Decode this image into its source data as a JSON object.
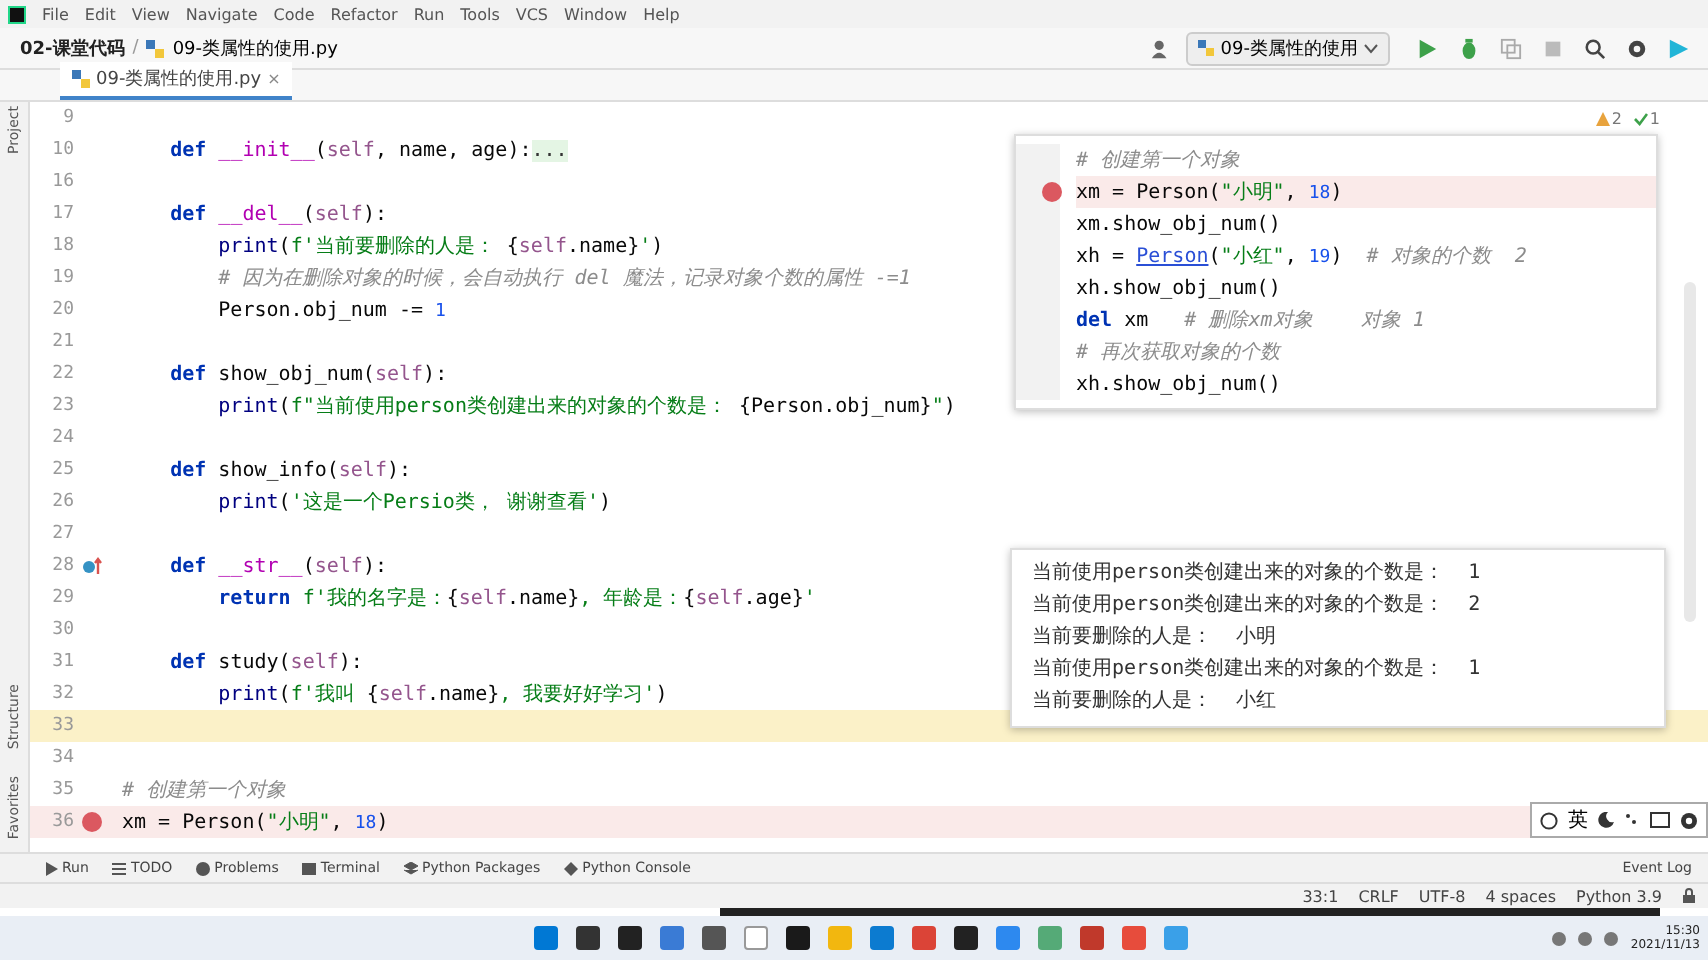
{
  "menu": [
    "File",
    "Edit",
    "View",
    "Navigate",
    "Code",
    "Refactor",
    "Run",
    "Tools",
    "VCS",
    "Window",
    "Help"
  ],
  "breadcrumb": {
    "project": "02-课堂代码",
    "separator": "/",
    "file": "09-类属性的使用.py"
  },
  "run_config": "09-类属性的使用",
  "tabs": [
    {
      "label": "09-类属性的使用.py",
      "close": "×",
      "selected": true
    }
  ],
  "side_tabs_top": [
    "Project"
  ],
  "side_tabs_bottom": [
    "Structure",
    "Favorites"
  ],
  "inspections": {
    "warnings": "2",
    "ok": "1"
  },
  "lines": [
    {
      "number": "9",
      "kind": "plain",
      "current": false
    },
    {
      "number": "10",
      "kind": "plain",
      "current": false,
      "segments": [
        {
          "kind": "kw",
          "text": "    def "
        },
        {
          "kind": "dunder",
          "text": "__init__"
        },
        {
          "kind": "plain",
          "text": "("
        },
        {
          "kind": "self",
          "text": "self"
        },
        {
          "kind": "plain",
          "text": ", name, age):"
        },
        {
          "kind": "folded",
          "text": "..."
        }
      ]
    },
    {
      "number": "16",
      "kind": "plain",
      "current": false
    },
    {
      "number": "17",
      "kind": "plain",
      "current": false,
      "segments": [
        {
          "kind": "kw",
          "text": "    def "
        },
        {
          "kind": "dunder",
          "text": "__del__"
        },
        {
          "kind": "plain",
          "text": "("
        },
        {
          "kind": "self",
          "text": "self"
        },
        {
          "kind": "plain",
          "text": "):"
        }
      ]
    },
    {
      "number": "18",
      "kind": "plain",
      "current": false,
      "segments": [
        {
          "kind": "builtin",
          "text": "        print"
        },
        {
          "kind": "plain",
          "text": "("
        },
        {
          "kind": "str",
          "text": "f'当前要删除的人是： "
        },
        {
          "kind": "plain",
          "text": "{"
        },
        {
          "kind": "self",
          "text": "self"
        },
        {
          "kind": "plain",
          "text": ".name}"
        },
        {
          "kind": "str",
          "text": "'"
        },
        {
          "kind": "plain",
          "text": ")"
        }
      ]
    },
    {
      "number": "19",
      "kind": "plain",
      "current": false,
      "segments": [
        {
          "kind": "comment",
          "text": "        # 因为在删除对象的时候，会自动执行 del 魔法，记录对象个数的属性 -=1"
        }
      ]
    },
    {
      "number": "20",
      "kind": "plain",
      "current": false,
      "segments": [
        {
          "kind": "plain",
          "text": "        Person.obj_num -= "
        },
        {
          "kind": "num",
          "text": "1"
        }
      ]
    },
    {
      "number": "21",
      "kind": "plain",
      "current": false
    },
    {
      "number": "22",
      "kind": "plain",
      "current": false,
      "segments": [
        {
          "kind": "kw",
          "text": "    def "
        },
        {
          "kind": "plain",
          "text": "show_obj_num("
        },
        {
          "kind": "self",
          "text": "self"
        },
        {
          "kind": "plain",
          "text": "):"
        }
      ]
    },
    {
      "number": "23",
      "kind": "plain",
      "current": false,
      "segments": [
        {
          "kind": "builtin",
          "text": "        print"
        },
        {
          "kind": "plain",
          "text": "("
        },
        {
          "kind": "str",
          "text": "f\"当前使用person类创建出来的对象的个数是： "
        },
        {
          "kind": "plain",
          "text": "{Person.obj_num}"
        },
        {
          "kind": "str",
          "text": "\""
        },
        {
          "kind": "plain",
          "text": ")"
        }
      ]
    },
    {
      "number": "24",
      "kind": "plain",
      "current": false
    },
    {
      "number": "25",
      "kind": "plain",
      "current": false,
      "segments": [
        {
          "kind": "kw",
          "text": "    def "
        },
        {
          "kind": "plain",
          "text": "show_info("
        },
        {
          "kind": "self",
          "text": "self"
        },
        {
          "kind": "plain",
          "text": "):"
        }
      ]
    },
    {
      "number": "26",
      "kind": "plain",
      "current": false,
      "segments": [
        {
          "kind": "builtin",
          "text": "        print"
        },
        {
          "kind": "plain",
          "text": "("
        },
        {
          "kind": "str",
          "text": "'这是一个Persio类， 谢谢查看'"
        },
        {
          "kind": "plain",
          "text": ")"
        }
      ]
    },
    {
      "number": "27",
      "kind": "plain",
      "current": false
    },
    {
      "number": "28",
      "kind": "override",
      "current": false,
      "segments": [
        {
          "kind": "kw",
          "text": "    def "
        },
        {
          "kind": "dunder",
          "text": "__str__"
        },
        {
          "kind": "plain",
          "text": "("
        },
        {
          "kind": "self",
          "text": "self"
        },
        {
          "kind": "plain",
          "text": "):"
        }
      ]
    },
    {
      "number": "29",
      "kind": "plain",
      "current": false,
      "segments": [
        {
          "kind": "kw",
          "text": "        return "
        },
        {
          "kind": "str",
          "text": "f'我的名字是："
        },
        {
          "kind": "plain",
          "text": "{"
        },
        {
          "kind": "self",
          "text": "self"
        },
        {
          "kind": "plain",
          "text": ".name}"
        },
        {
          "kind": "str",
          "text": ", 年龄是："
        },
        {
          "kind": "plain",
          "text": "{"
        },
        {
          "kind": "self",
          "text": "self"
        },
        {
          "kind": "plain",
          "text": ".age}"
        },
        {
          "kind": "str",
          "text": "'"
        }
      ]
    },
    {
      "number": "30",
      "kind": "plain",
      "current": false
    },
    {
      "number": "31",
      "kind": "plain",
      "current": false,
      "segments": [
        {
          "kind": "kw",
          "text": "    def "
        },
        {
          "kind": "plain",
          "text": "study("
        },
        {
          "kind": "self",
          "text": "self"
        },
        {
          "kind": "plain",
          "text": "):"
        }
      ]
    },
    {
      "number": "32",
      "kind": "plain",
      "current": false,
      "segments": [
        {
          "kind": "builtin",
          "text": "        print"
        },
        {
          "kind": "plain",
          "text": "("
        },
        {
          "kind": "str",
          "text": "f'我叫 "
        },
        {
          "kind": "plain",
          "text": "{"
        },
        {
          "kind": "self",
          "text": "self"
        },
        {
          "kind": "plain",
          "text": ".name}"
        },
        {
          "kind": "str",
          "text": ", 我要好好学习'"
        },
        {
          "kind": "plain",
          "text": ")"
        }
      ]
    },
    {
      "number": "33",
      "kind": "plain",
      "current": true
    },
    {
      "number": "34",
      "kind": "plain",
      "current": false
    },
    {
      "number": "35",
      "kind": "plain",
      "current": false,
      "segments": [
        {
          "kind": "comment",
          "text": "# 创建第一个对象"
        }
      ]
    },
    {
      "number": "36",
      "kind": "breakpoint",
      "current": false,
      "segments": [
        {
          "kind": "plain",
          "text": "xm = Person("
        },
        {
          "kind": "str",
          "text": "\"小明\""
        },
        {
          "kind": "plain",
          "text": ", "
        },
        {
          "kind": "num",
          "text": "18"
        },
        {
          "kind": "plain",
          "text": ")"
        }
      ]
    }
  ],
  "preview_lines": [
    {
      "kind": "plain",
      "segments": [
        {
          "kind": "comment",
          "text": "# 创建第一个对象"
        }
      ]
    },
    {
      "kind": "breakpoint",
      "segments": [
        {
          "kind": "plain",
          "text": "xm = Person("
        },
        {
          "kind": "str",
          "text": "\"小明\""
        },
        {
          "kind": "plain",
          "text": ", "
        },
        {
          "kind": "num",
          "text": "18"
        },
        {
          "kind": "plain",
          "text": ")"
        }
      ]
    },
    {
      "kind": "plain",
      "segments": [
        {
          "kind": "plain",
          "text": "xm.show_obj_num()"
        }
      ]
    },
    {
      "kind": "plain",
      "segments": [
        {
          "kind": "plain",
          "text": "xh = "
        },
        {
          "kind": "link",
          "text": "Person"
        },
        {
          "kind": "plain",
          "text": "("
        },
        {
          "kind": "str",
          "text": "\"小红\""
        },
        {
          "kind": "plain",
          "text": ", "
        },
        {
          "kind": "num",
          "text": "19"
        },
        {
          "kind": "plain",
          "text": ")"
        },
        {
          "kind": "comment",
          "text": "  # 对象的个数  2"
        }
      ]
    },
    {
      "kind": "plain",
      "segments": [
        {
          "kind": "plain",
          "text": "xh.show_obj_num()"
        }
      ]
    },
    {
      "kind": "plain",
      "segments": [
        {
          "kind": "kw",
          "text": "del"
        },
        {
          "kind": "plain",
          "text": " xm"
        },
        {
          "kind": "comment",
          "text": "   # 删除xm对象    对象 1"
        }
      ]
    },
    {
      "kind": "plain",
      "segments": [
        {
          "kind": "comment",
          "text": "# 再次获取对象的个数"
        }
      ]
    },
    {
      "kind": "plain",
      "segments": [
        {
          "kind": "plain",
          "text": "xh.show_obj_num()"
        }
      ]
    }
  ],
  "output_lines": [
    "当前使用person类创建出来的对象的个数是：  1",
    "当前使用person类创建出来的对象的个数是：  2",
    "当前要删除的人是：  小明",
    "当前使用person类创建出来的对象的个数是：  1",
    "当前要删除的人是：  小红"
  ],
  "ime": {
    "language": "英"
  },
  "tool_tabs": [
    "Run",
    "TODO",
    "Problems",
    "Terminal",
    "Python Packages",
    "Python Console"
  ],
  "event_log": "Event Log",
  "status": [
    "33:1",
    "CRLF",
    "UTF-8",
    "4 spaces",
    "Python 3.9"
  ],
  "clock": {
    "time": "15:30",
    "date": "2021/11/13"
  }
}
